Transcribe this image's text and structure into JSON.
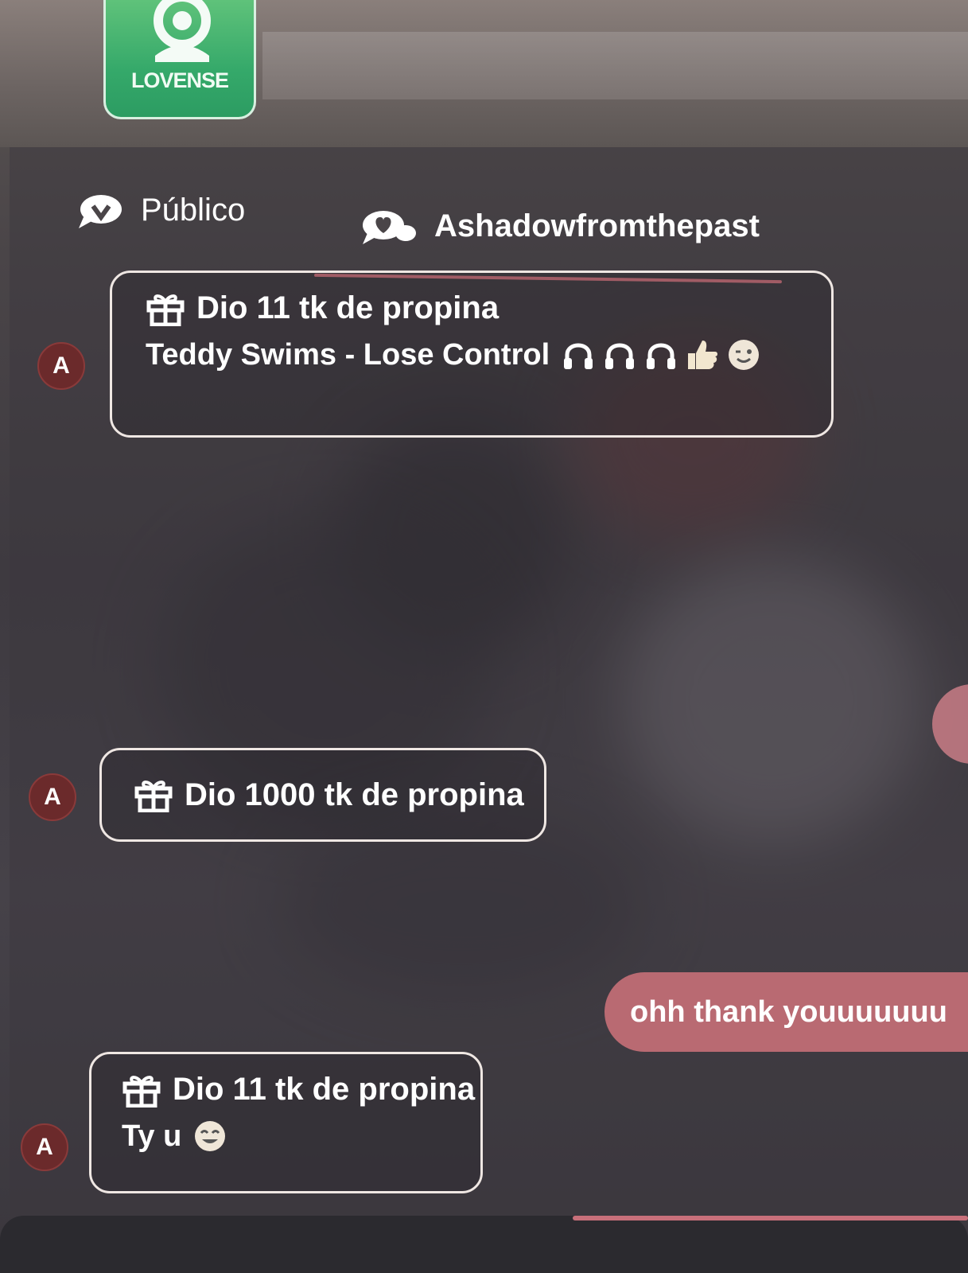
{
  "lovense": {
    "label": "LOVENSE"
  },
  "tabs": {
    "public": {
      "label": "Público"
    },
    "private": {
      "label": "Ashadowfromthepast"
    }
  },
  "messages": [
    {
      "avatar": "A",
      "tip": "Dio 11 tk de propina",
      "text": "Teddy Swims - Lose Control",
      "emojis": [
        "headphones-icon",
        "headphones-icon",
        "headphones-icon",
        "thumbs-up-icon",
        "winking-face-icon"
      ]
    },
    {
      "avatar": "A",
      "tip": "Dio 1000 tk de propina"
    },
    {
      "avatar": "A",
      "tip": "Dio 11 tk de propina",
      "text": "Ty u",
      "emojis": [
        "smiling-face-icon"
      ]
    }
  ],
  "sent_message": {
    "text": "ohh thank youuuuuuu"
  },
  "colors": {
    "accent": "#e27a84",
    "sent_bubble": "#b96a72",
    "avatar_bg": "#6b2a2b",
    "lovense_green": "#35a96a"
  }
}
